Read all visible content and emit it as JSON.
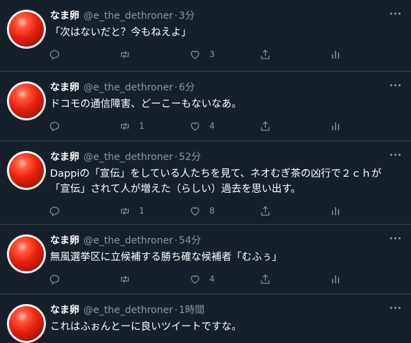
{
  "tweets": [
    {
      "name": "なま卵",
      "handle": "@e_the_dethroner",
      "time": "3分",
      "text": "「次はないだと？今もねえよ」",
      "replies": "",
      "retweets": "",
      "likes": "3"
    },
    {
      "name": "なま卵",
      "handle": "@e_the_dethroner",
      "time": "6分",
      "text": "ドコモの通信障害、どーこーもないなあ。",
      "replies": "",
      "retweets": "1",
      "likes": "4"
    },
    {
      "name": "なま卵",
      "handle": "@e_the_dethroner",
      "time": "52分",
      "text": "Dappiの「宣伝」をしている人たちを見て、ネオむぎ茶の凶行で２ｃｈが「宣伝」されて人が増えた（らしい）過去を思い出す。",
      "replies": "",
      "retweets": "1",
      "likes": "8"
    },
    {
      "name": "なま卵",
      "handle": "@e_the_dethroner",
      "time": "54分",
      "text": "無風選挙区に立候補する勝ち確な候補者「むふぅ」",
      "replies": "",
      "retweets": "",
      "likes": "4"
    },
    {
      "name": "なま卵",
      "handle": "@e_the_dethroner",
      "time": "1時間",
      "text": "これはふぉんとーに良いツイートですな。",
      "replies": "",
      "retweets": "",
      "likes": ""
    }
  ],
  "icons": {
    "reply": "reply-icon",
    "retweet": "retweet-icon",
    "like": "heart-icon",
    "analytics": "analytics-icon",
    "more": "more-icon"
  },
  "colors": {
    "background": "#15202b",
    "divider": "#38444d",
    "secondary_text": "#8899a6",
    "primary_text": "#ffffff"
  }
}
